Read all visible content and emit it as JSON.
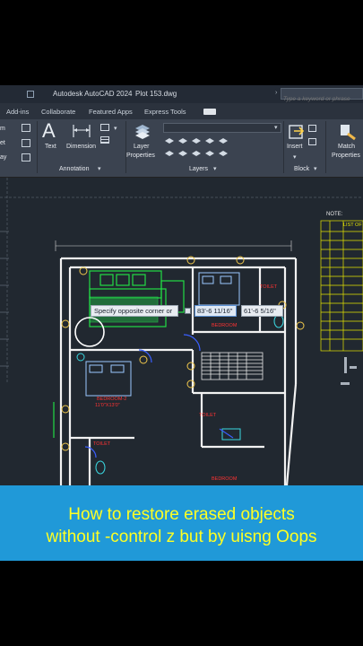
{
  "window": {
    "app_title": "Autodesk AutoCAD 2024",
    "file_name": "Plot 153.dwg"
  },
  "search": {
    "placeholder": "Type a keyword or phrase"
  },
  "ribbon_tabs": [
    "Add-ins",
    "Collaborate",
    "Featured Apps",
    "Express Tools"
  ],
  "ribbon": {
    "left_partial": [
      "m",
      "et",
      "ay"
    ],
    "text_label": "Text",
    "dimension_label": "Dimension",
    "annotation_panel": "Annotation",
    "layer_properties_line1": "Layer",
    "layer_properties_line2": "Properties",
    "layers_panel": "Layers",
    "insert_label": "Insert",
    "block_panel": "Block",
    "match_line1": "Match",
    "match_line2": "Properties"
  },
  "drawing": {
    "command_prompt": "Specify opposite corner or",
    "input_value_1": "83'-6 11/16\"",
    "input_value_2": "61'-6 5/16\"",
    "note_label": "NOTE:",
    "list_label": "LIST OF"
  },
  "caption": {
    "line1": "How to restore erased objects",
    "line2": "without -control z but by uisng Oops"
  },
  "colors": {
    "background": "#000000",
    "ribbon": "#3b4350",
    "canvas": "#212830",
    "caption_bg": "#2099d8",
    "caption_text": "#ffff22",
    "plan_walls": "#ffffff",
    "plan_furniture": "#22dd44",
    "plan_labels": "#ff3333",
    "table_lines": "#e6e600"
  }
}
